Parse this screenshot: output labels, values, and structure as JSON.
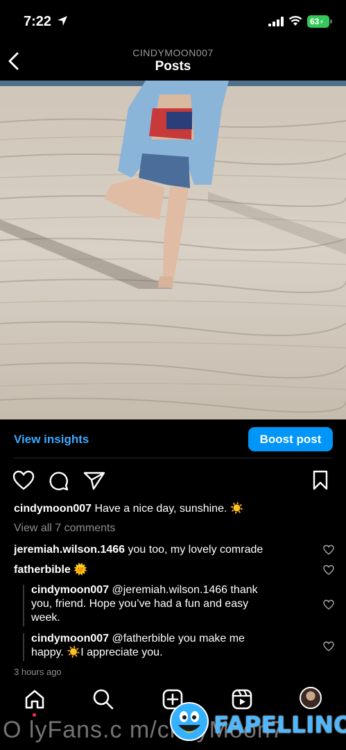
{
  "status_bar": {
    "time": "7:22",
    "battery": "63"
  },
  "header": {
    "username": "CINDYMOON007",
    "title": "Posts"
  },
  "post_actions": {
    "view_insights": "View insights",
    "boost_post": "Boost post"
  },
  "caption": {
    "username": "cindymoon007",
    "text": "Have a nice day, sunshine. ☀️"
  },
  "view_all_comments": "View all 7 comments",
  "comments": [
    {
      "username": "jeremiah.wilson.1466",
      "text": "you too, my lovely comrade"
    },
    {
      "username": "fatherbible",
      "text": "🌞"
    }
  ],
  "replies": [
    {
      "username": "cindymoon007",
      "line1": "@jeremiah.wilson.1466 thank",
      "line2": "you, friend. Hope you’ve had a fun and easy",
      "line3": "week."
    },
    {
      "username": "cindymoon007",
      "line1": "@fatherbible you make me",
      "line2": "happy. ☀️I appreciate you."
    }
  ],
  "posted_time": "3 hours ago",
  "watermark": {
    "text": "O lyFans.c m/ci dyMoon7",
    "brand": "FAPELLINO"
  },
  "colors": {
    "accent": "#0095f6",
    "link": "#3ea8ff",
    "battery": "#34c759"
  }
}
